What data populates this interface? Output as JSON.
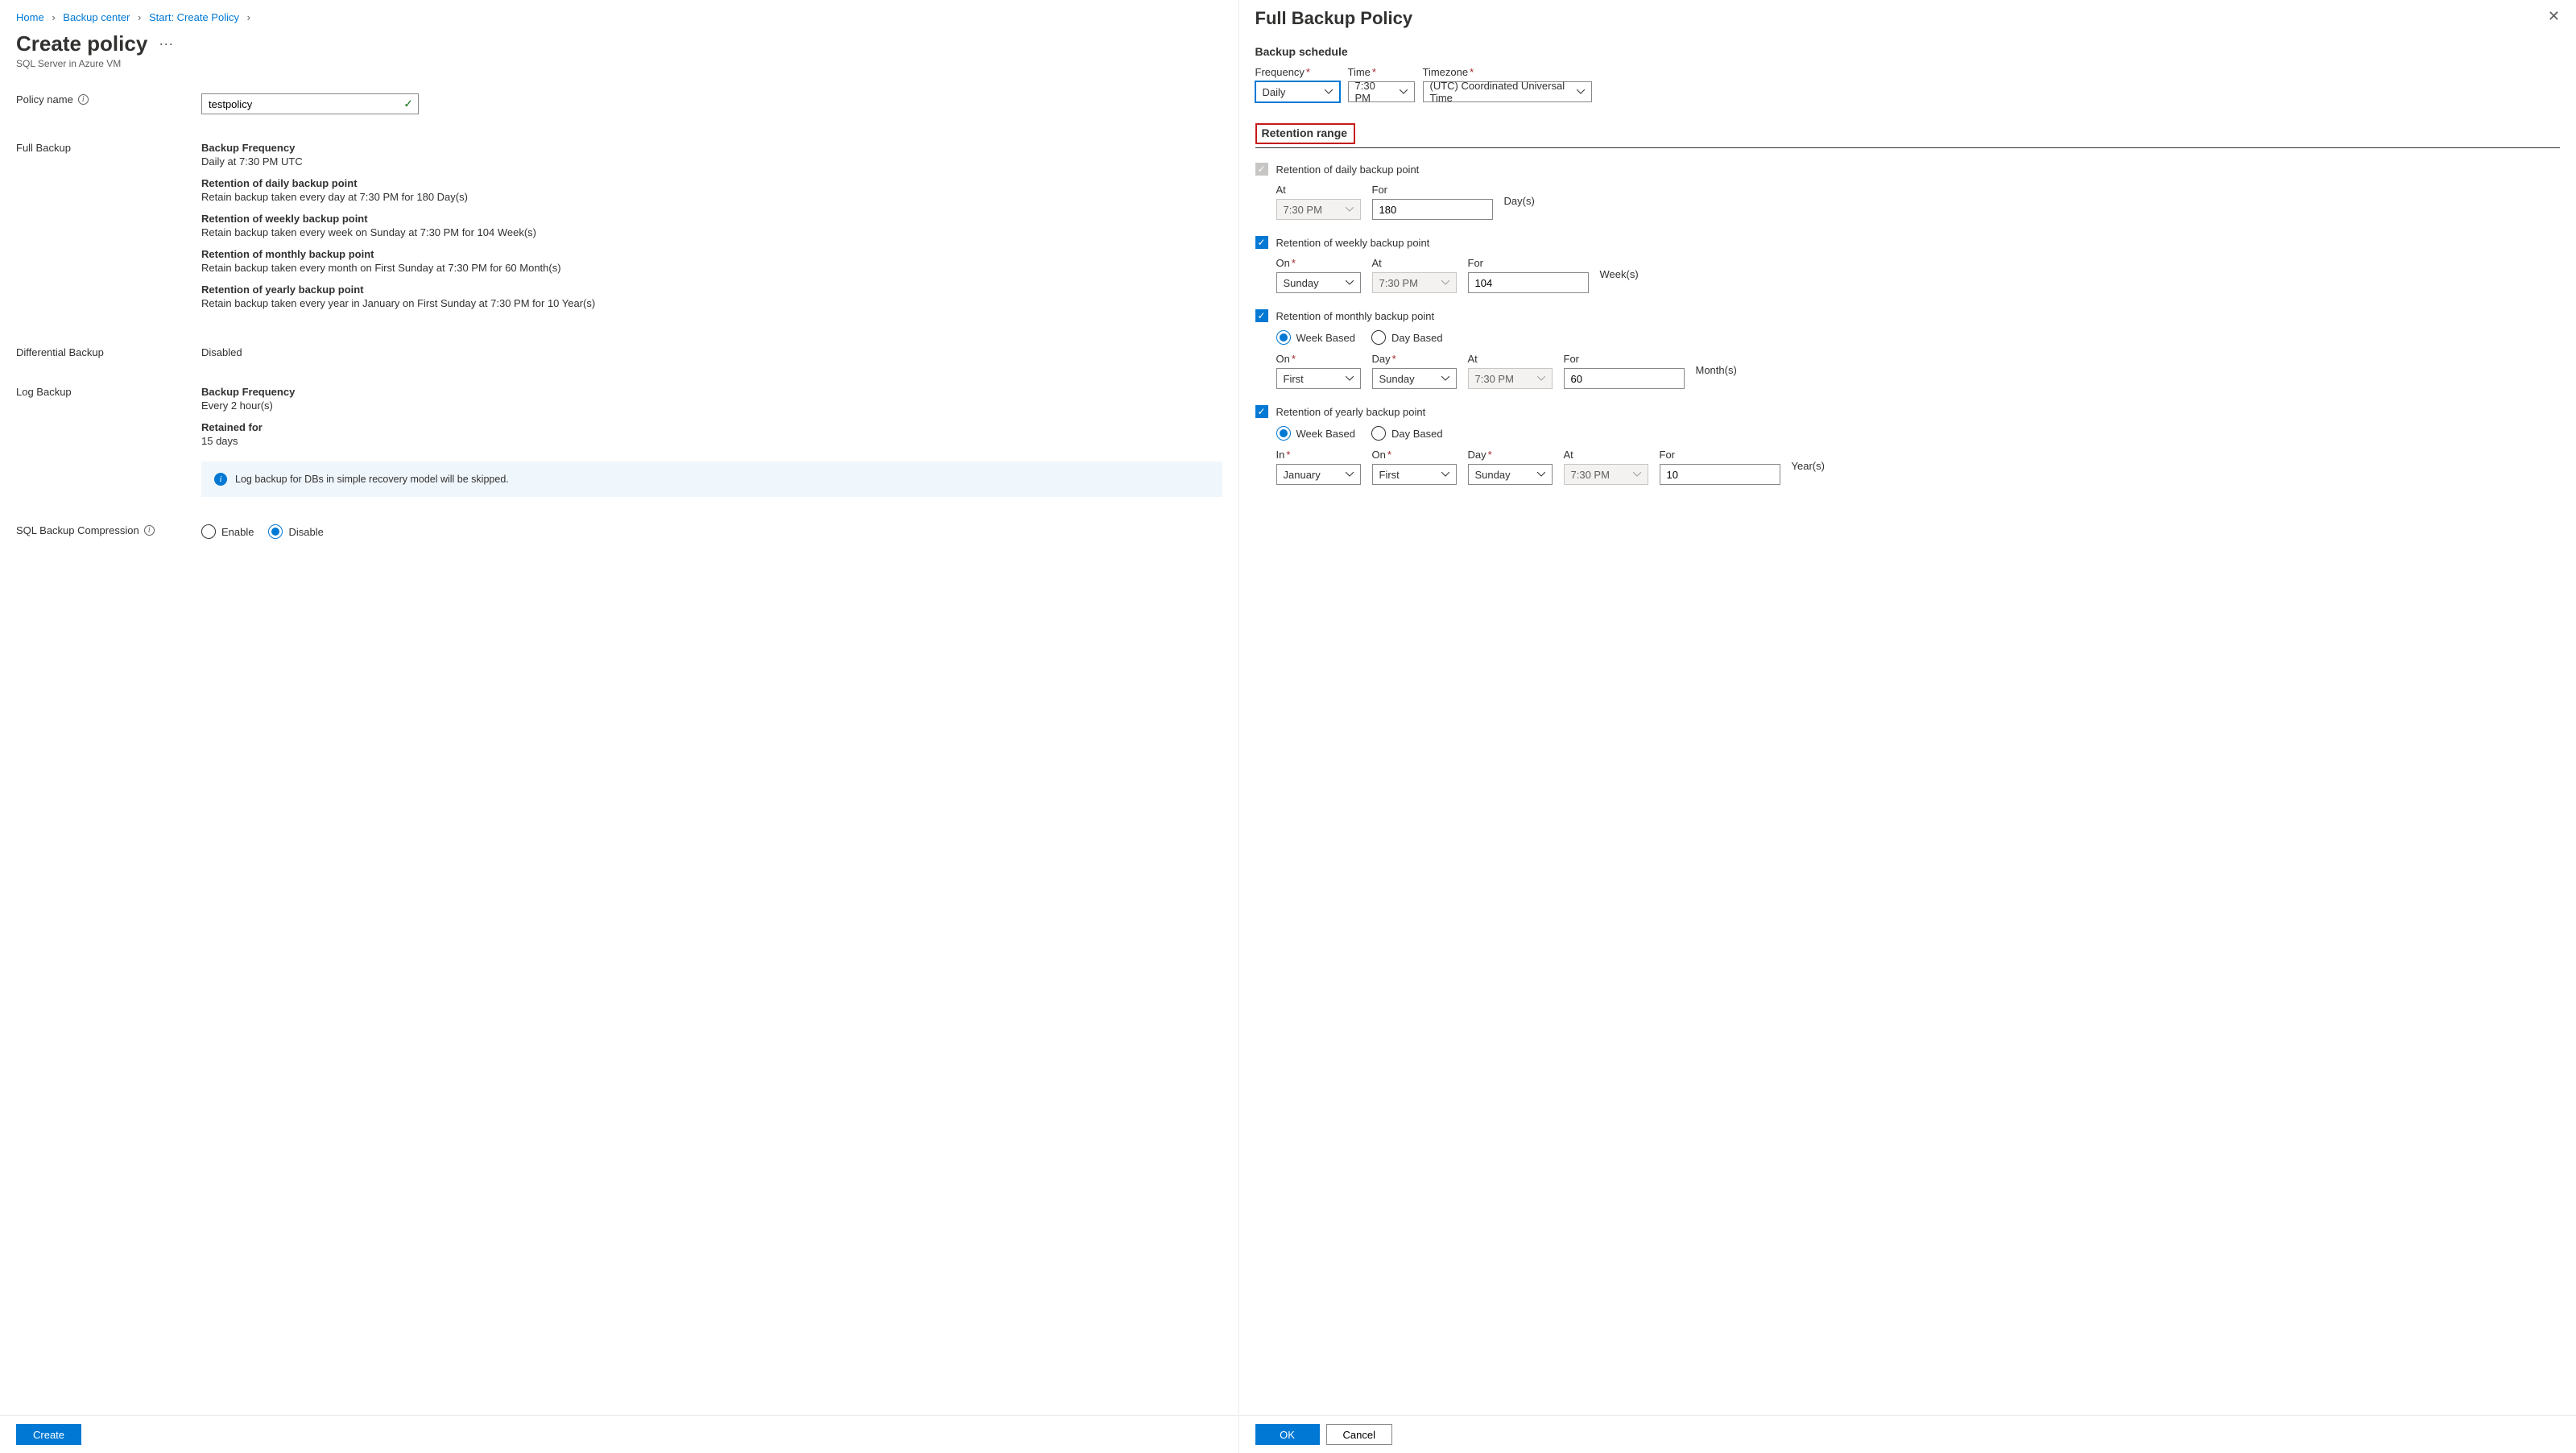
{
  "breadcrumb": {
    "home": "Home",
    "backup_center": "Backup center",
    "start_create_policy": "Start: Create Policy"
  },
  "left": {
    "title": "Create policy",
    "subtitle": "SQL Server in Azure VM",
    "policy_name_label": "Policy name",
    "policy_name_value": "testpolicy",
    "sections": {
      "full_backup": {
        "label": "Full Backup",
        "freq_title": "Backup Frequency",
        "freq_text": "Daily at 7:30 PM UTC",
        "daily_title": "Retention of daily backup point",
        "daily_text": "Retain backup taken every day at 7:30 PM for 180 Day(s)",
        "weekly_title": "Retention of weekly backup point",
        "weekly_text": "Retain backup taken every week on Sunday at 7:30 PM for 104 Week(s)",
        "monthly_title": "Retention of monthly backup point",
        "monthly_text": "Retain backup taken every month on First Sunday at 7:30 PM for 60 Month(s)",
        "yearly_title": "Retention of yearly backup point",
        "yearly_text": "Retain backup taken every year in January on First Sunday at 7:30 PM for 10 Year(s)"
      },
      "differential_backup": {
        "label": "Differential Backup",
        "text": "Disabled"
      },
      "log_backup": {
        "label": "Log Backup",
        "freq_title": "Backup Frequency",
        "freq_text": "Every 2 hour(s)",
        "retain_title": "Retained for",
        "retain_text": "15 days",
        "info": "Log backup for DBs in simple recovery model will be skipped."
      },
      "compression": {
        "label": "SQL Backup Compression",
        "enable": "Enable",
        "disable": "Disable"
      }
    },
    "footer": {
      "create": "Create"
    }
  },
  "right": {
    "title": "Full Backup Policy",
    "schedule": {
      "heading": "Backup schedule",
      "frequency_label": "Frequency",
      "frequency_value": "Daily",
      "time_label": "Time",
      "time_value": "7:30 PM",
      "timezone_label": "Timezone",
      "timezone_value": "(UTC) Coordinated Universal Time"
    },
    "retention": {
      "heading": "Retention range",
      "daily": {
        "label": "Retention of daily backup point",
        "at_label": "At",
        "at_value": "7:30 PM",
        "for_label": "For",
        "for_value": "180",
        "suffix": "Day(s)"
      },
      "weekly": {
        "label": "Retention of weekly backup point",
        "on_label": "On",
        "on_value": "Sunday",
        "at_label": "At",
        "at_value": "7:30 PM",
        "for_label": "For",
        "for_value": "104",
        "suffix": "Week(s)"
      },
      "monthly": {
        "label": "Retention of monthly backup point",
        "week_based": "Week Based",
        "day_based": "Day Based",
        "on_label": "On",
        "on_value": "First",
        "day_label": "Day",
        "day_value": "Sunday",
        "at_label": "At",
        "at_value": "7:30 PM",
        "for_label": "For",
        "for_value": "60",
        "suffix": "Month(s)"
      },
      "yearly": {
        "label": "Retention of yearly backup point",
        "week_based": "Week Based",
        "day_based": "Day Based",
        "in_label": "In",
        "in_value": "January",
        "on_label": "On",
        "on_value": "First",
        "day_label": "Day",
        "day_value": "Sunday",
        "at_label": "At",
        "at_value": "7:30 PM",
        "for_label": "For",
        "for_value": "10",
        "suffix": "Year(s)"
      }
    },
    "footer": {
      "ok": "OK",
      "cancel": "Cancel"
    }
  }
}
